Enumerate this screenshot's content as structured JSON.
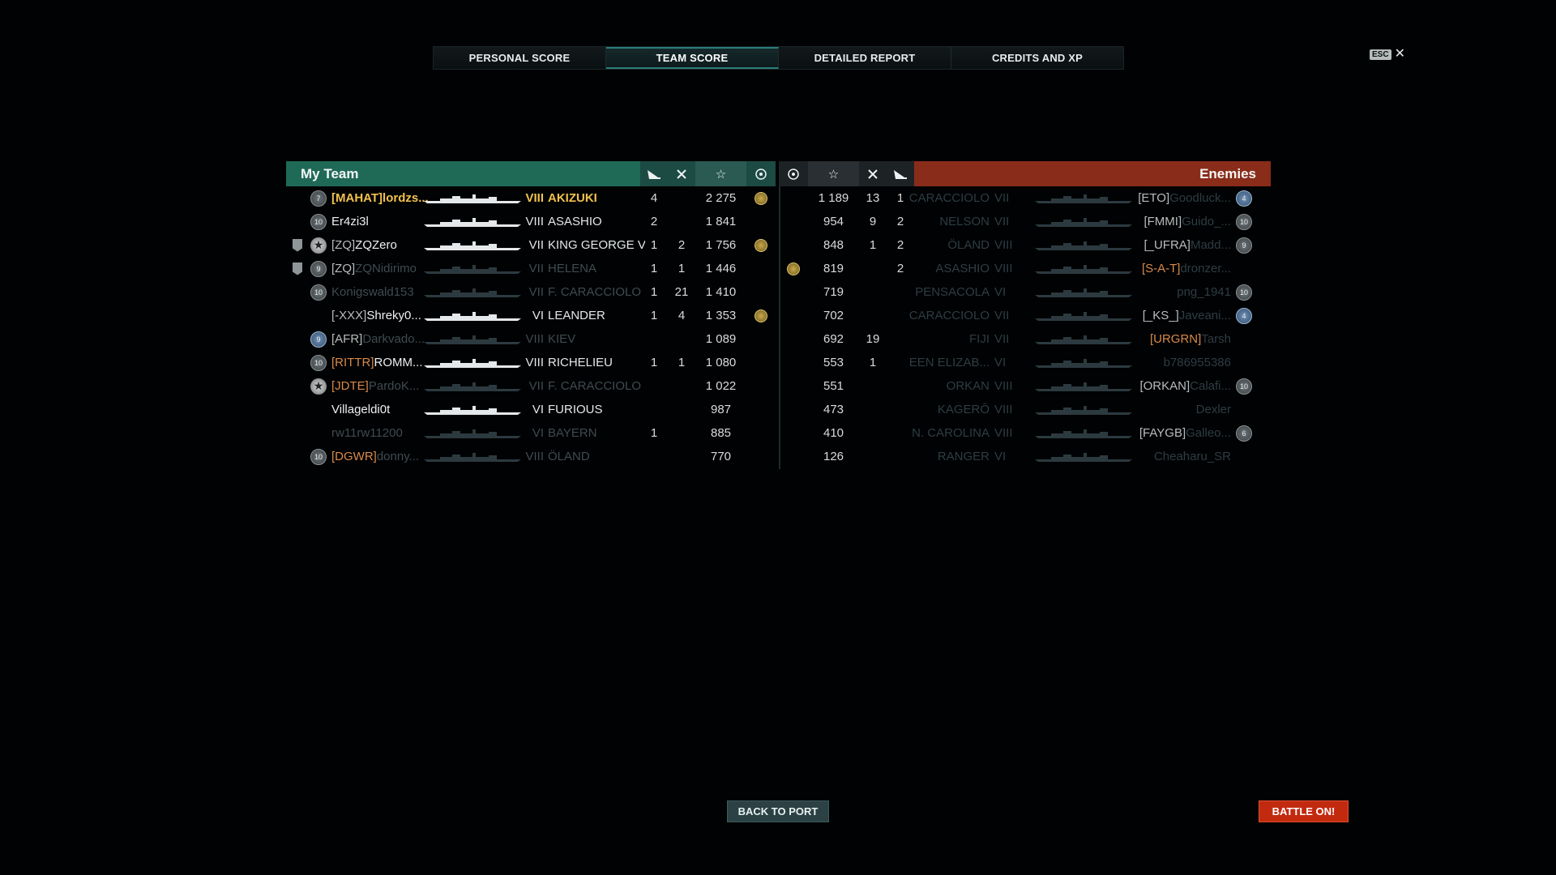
{
  "tabs": [
    "PERSONAL SCORE",
    "TEAM SCORE",
    "DETAILED REPORT",
    "CREDITS AND XP"
  ],
  "esc_label": "ESC",
  "my_team": {
    "title": "My Team",
    "header_icons": [
      "plane-icon",
      "swords-icon",
      "star-icon",
      "laurel-icon"
    ],
    "rows": [
      {
        "rank": "7",
        "rank_style": "grey",
        "clan": "[MAHAT]",
        "name": "lordzs...",
        "tier": "VIII",
        "ship": "AKIZUKI",
        "planes": "4",
        "frags": "",
        "xp": "2 275",
        "medal": true,
        "style": "self"
      },
      {
        "rank": "10",
        "rank_style": "grey",
        "clan": "",
        "name": "Er4zi3l",
        "tier": "VIII",
        "ship": "ASASHIO",
        "planes": "2",
        "frags": "",
        "xp": "1 841",
        "medal": false,
        "style": "alive"
      },
      {
        "rank": "★",
        "rank_style": "star",
        "division": true,
        "clan": "[ZQ]",
        "name": "ZQZero",
        "tier": "VII",
        "ship": "KING GEORGE V",
        "planes": "1",
        "frags": "2",
        "xp": "1 756",
        "medal": true,
        "style": "alive"
      },
      {
        "rank": "9",
        "rank_style": "grey",
        "division": true,
        "clan": "[ZQ]",
        "name": "ZQNidirimo",
        "tier": "VII",
        "ship": "HELENA",
        "planes": "1",
        "frags": "1",
        "xp": "1 446",
        "medal": false,
        "style": "dead-name"
      },
      {
        "rank": "10",
        "rank_style": "grey",
        "clan": "",
        "name": "Konigswald153",
        "tier": "VII",
        "ship": "F. CARACCIOLO",
        "planes": "1",
        "frags": "21",
        "xp": "1 410",
        "medal": false,
        "style": "dead"
      },
      {
        "rank": "",
        "rank_style": "none",
        "clan": "[-XXX]",
        "name": "Shreky0...",
        "tier": "VI",
        "ship": "LEANDER",
        "planes": "1",
        "frags": "4",
        "xp": "1 353",
        "medal": true,
        "style": "alive"
      },
      {
        "rank": "9",
        "rank_style": "blue",
        "clan": "[AFR]",
        "name": "Darkvado...",
        "tier": "VIII",
        "ship": "KIEV",
        "planes": "",
        "frags": "",
        "xp": "1 089",
        "medal": false,
        "style": "dead-name"
      },
      {
        "rank": "10",
        "rank_style": "grey",
        "clan": "[RITTR]",
        "name": "ROMM...",
        "tier": "VIII",
        "ship": "RICHELIEU",
        "planes": "1",
        "frags": "1",
        "xp": "1 080",
        "medal": false,
        "style": "alive-orange"
      },
      {
        "rank": "★",
        "rank_style": "star",
        "clan": "[JDTE]",
        "name": "PardoK...",
        "tier": "VII",
        "ship": "F. CARACCIOLO",
        "planes": "",
        "frags": "",
        "xp": "1 022",
        "medal": false,
        "style": "dead-orange"
      },
      {
        "rank": "",
        "rank_style": "none",
        "clan": "",
        "name": "Villageldi0t",
        "tier": "VI",
        "ship": "FURIOUS",
        "planes": "",
        "frags": "",
        "xp": "987",
        "medal": false,
        "style": "alive"
      },
      {
        "rank": "",
        "rank_style": "none",
        "clan": "",
        "name": "rw11rw11200",
        "tier": "VI",
        "ship": "BAYERN",
        "planes": "1",
        "frags": "",
        "xp": "885",
        "medal": false,
        "style": "dead"
      },
      {
        "rank": "10",
        "rank_style": "grey",
        "clan": "[DGWR]",
        "name": "donny...",
        "tier": "VIII",
        "ship": "ÖLAND",
        "planes": "",
        "frags": "",
        "xp": "770",
        "medal": false,
        "style": "dead-orange"
      }
    ]
  },
  "enemies": {
    "title": "Enemies",
    "header_icons": [
      "laurel-icon",
      "star-icon",
      "swords-icon",
      "plane-icon"
    ],
    "rows": [
      {
        "medal": false,
        "xp": "1 189",
        "frags": "13",
        "planes": "1",
        "ship": "F. CARACCIOLO",
        "tier": "VII",
        "clan": "[ETO]",
        "name": "Goodluck...",
        "rank": "4",
        "rank_style": "blue",
        "style": "dead-name"
      },
      {
        "medal": false,
        "xp": "954",
        "frags": "9",
        "planes": "2",
        "ship": "NELSON",
        "tier": "VII",
        "clan": "[FMMI]",
        "name": "Guido_...",
        "rank": "10",
        "rank_style": "grey",
        "style": "dead-name"
      },
      {
        "medal": false,
        "xp": "848",
        "frags": "1",
        "planes": "2",
        "ship": "ÖLAND",
        "tier": "VIII",
        "clan": "[_UFRA]",
        "name": "Madd...",
        "rank": "9",
        "rank_style": "grey",
        "style": "dead-name"
      },
      {
        "medal": true,
        "xp": "819",
        "frags": "",
        "planes": "2",
        "ship": "ASASHIO",
        "tier": "VIII",
        "clan": "[S-A-T]",
        "name": "dronzer...",
        "rank": "",
        "rank_style": "none",
        "style": "dead-orange"
      },
      {
        "medal": false,
        "xp": "719",
        "frags": "",
        "planes": "",
        "ship": "PENSACOLA",
        "tier": "VI",
        "clan": "",
        "name": "png_1941",
        "rank": "10",
        "rank_style": "grey",
        "style": "dead"
      },
      {
        "medal": false,
        "xp": "702",
        "frags": "",
        "planes": "",
        "ship": "F. CARACCIOLO",
        "tier": "VII",
        "clan": "[_KS_]",
        "name": "Javeani...",
        "rank": "4",
        "rank_style": "blue",
        "style": "dead-name"
      },
      {
        "medal": false,
        "xp": "692",
        "frags": "19",
        "planes": "",
        "ship": "FIJI",
        "tier": "VII",
        "clan": "[URGRN]",
        "name": "Tarsh",
        "rank": "",
        "rank_style": "none",
        "style": "dead-orange"
      },
      {
        "medal": false,
        "xp": "553",
        "frags": "1",
        "planes": "",
        "ship": "QUEEN ELIZAB...",
        "tier": "VI",
        "clan": "",
        "name": "b786955386",
        "rank": "",
        "rank_style": "none",
        "style": "dead"
      },
      {
        "medal": false,
        "xp": "551",
        "frags": "",
        "planes": "",
        "ship": "ORKAN",
        "tier": "VIII",
        "clan": "[ORKAN]",
        "name": "Calafi...",
        "rank": "10",
        "rank_style": "grey",
        "style": "dead-name"
      },
      {
        "medal": false,
        "xp": "473",
        "frags": "",
        "planes": "",
        "ship": "KAGERŌ",
        "tier": "VIII",
        "clan": "",
        "name": "Dexler",
        "rank": "",
        "rank_style": "none",
        "style": "dead"
      },
      {
        "medal": false,
        "xp": "410",
        "frags": "",
        "planes": "",
        "ship": "N. CAROLINA",
        "tier": "VIII",
        "clan": "[FAYGB]",
        "name": "Galleo...",
        "rank": "6",
        "rank_style": "grey",
        "style": "dead-name"
      },
      {
        "medal": false,
        "xp": "126",
        "frags": "",
        "planes": "",
        "ship": "RANGER",
        "tier": "VI",
        "clan": "",
        "name": "Cheaharu_SR",
        "rank": "",
        "rank_style": "none",
        "style": "dead"
      }
    ]
  },
  "buttons": {
    "back": "BACK TO PORT",
    "battle": "BATTLE ON!"
  }
}
